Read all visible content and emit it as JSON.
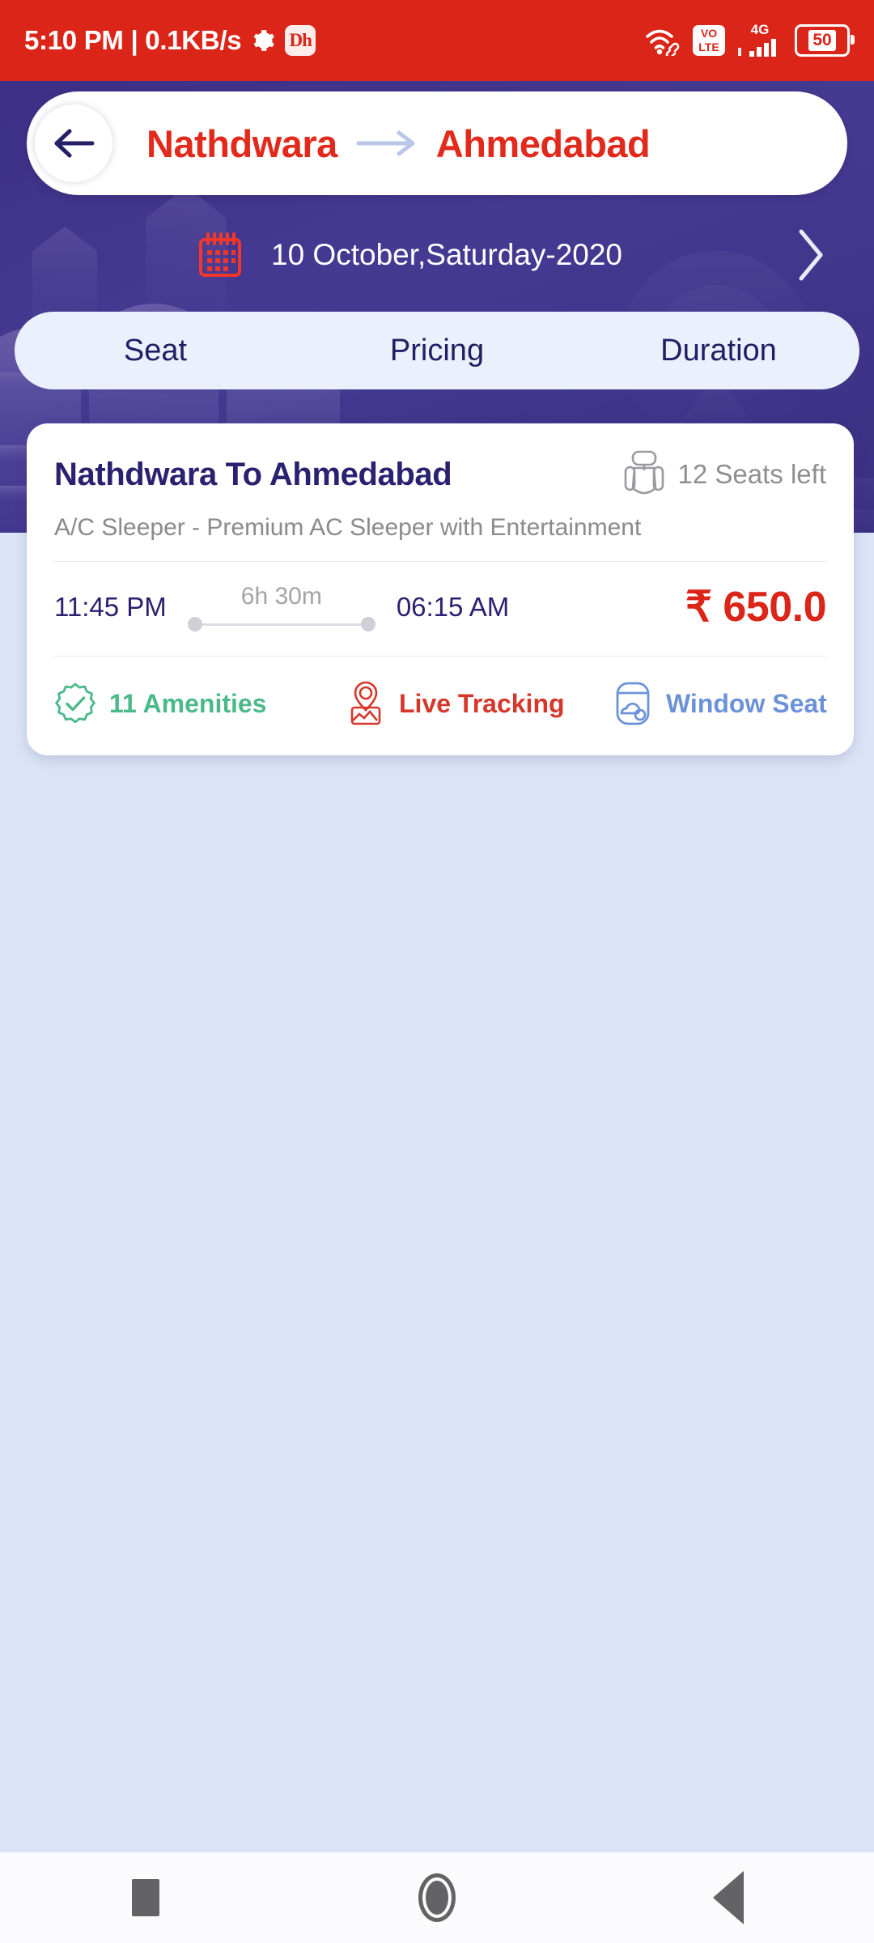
{
  "status_bar": {
    "clock": "5:10 PM | 0.1KB/s",
    "gear_icon": "gear-icon",
    "app_icon_label": "Dh",
    "wifi_icon": "wifi-icon",
    "volte_line1": "VO",
    "volte_line2": "LTE",
    "network_label": "4G",
    "signal_icon": "signal-bars-icon",
    "battery_level": "50"
  },
  "header": {
    "back_icon": "back-arrow-icon",
    "origin": "Nathdwara",
    "arrow_icon": "arrow-right-icon",
    "destination": "Ahmedabad"
  },
  "date_bar": {
    "calendar_icon": "calendar-icon",
    "date": "10 October,Saturday-2020",
    "next_icon": "chevron-right-icon"
  },
  "sort_tabs": [
    {
      "label": "Seat"
    },
    {
      "label": "Pricing"
    },
    {
      "label": "Duration"
    }
  ],
  "result": {
    "operator": "Nathdwara To Ahmedabad",
    "seat_icon": "bus-seat-icon",
    "seats_left": "12 Seats left",
    "bus_type": "A/C  Sleeper - Premium AC Sleeper with Entertainment",
    "departure_time": "11:45 PM",
    "duration": "6h 30m",
    "arrival_time": "06:15 AM",
    "price": "₹ 650.0",
    "features": [
      {
        "label": "11 Amenities",
        "icon": "badge-check-icon",
        "color": "#4cb98a"
      },
      {
        "label": "Live Tracking",
        "icon": "map-pin-icon",
        "color": "#d6372b"
      },
      {
        "label": "Window Seat",
        "icon": "window-icon",
        "color": "#6b92d8"
      }
    ]
  },
  "bottom_nav": [
    {
      "label": "recents-button"
    },
    {
      "label": "home-button"
    },
    {
      "label": "back-button"
    }
  ],
  "colors": {
    "status_red": "#dc2519",
    "hero_purple": "#3d2f86",
    "page_bg": "#dbe4f7",
    "brand_red": "#e12a1c",
    "navy": "#2a2170"
  }
}
